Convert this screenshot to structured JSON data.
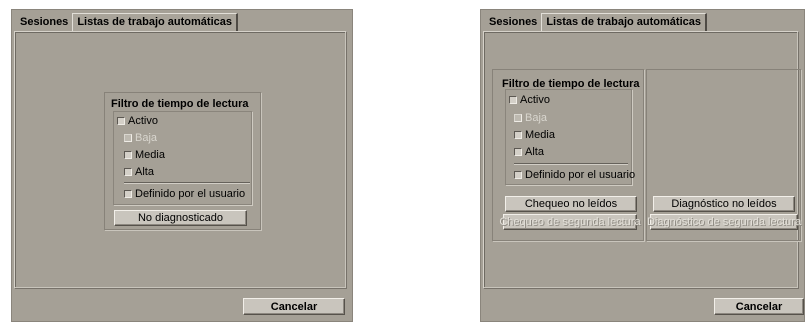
{
  "tabs": [
    "Sesiones",
    "Listas de trabajo automáticas"
  ],
  "filter": {
    "title": "Filtro de tiempo de lectura",
    "options": [
      {
        "label": "Activo",
        "checked": false,
        "disabled": false
      },
      {
        "label": "Baja",
        "checked": false,
        "disabled": true
      },
      {
        "label": "Media",
        "checked": false,
        "disabled": false
      },
      {
        "label": "Alta",
        "checked": false,
        "disabled": false
      },
      {
        "label": "Definido por el usuario",
        "checked": false,
        "disabled": false
      }
    ]
  },
  "left_panel": {
    "action_button": "No diagnosticado",
    "cancel_button": "Cancelar"
  },
  "right_panel": {
    "buttons": {
      "chequeo_no_leidos": "Chequeo no leídos",
      "chequeo_segunda_lectura": "Chequeo de segunda lectura",
      "diagnostico_no_leidos": "Diagnóstico no leídos",
      "diagnostico_segunda_lectura": "Diagnóstico de segunda lectura"
    },
    "cancel_button": "Cancelar"
  },
  "colors": {
    "panel_bg": "#a5a096",
    "button_bg": "#c9c5bd",
    "disabled_text": "#d9d6cf"
  }
}
